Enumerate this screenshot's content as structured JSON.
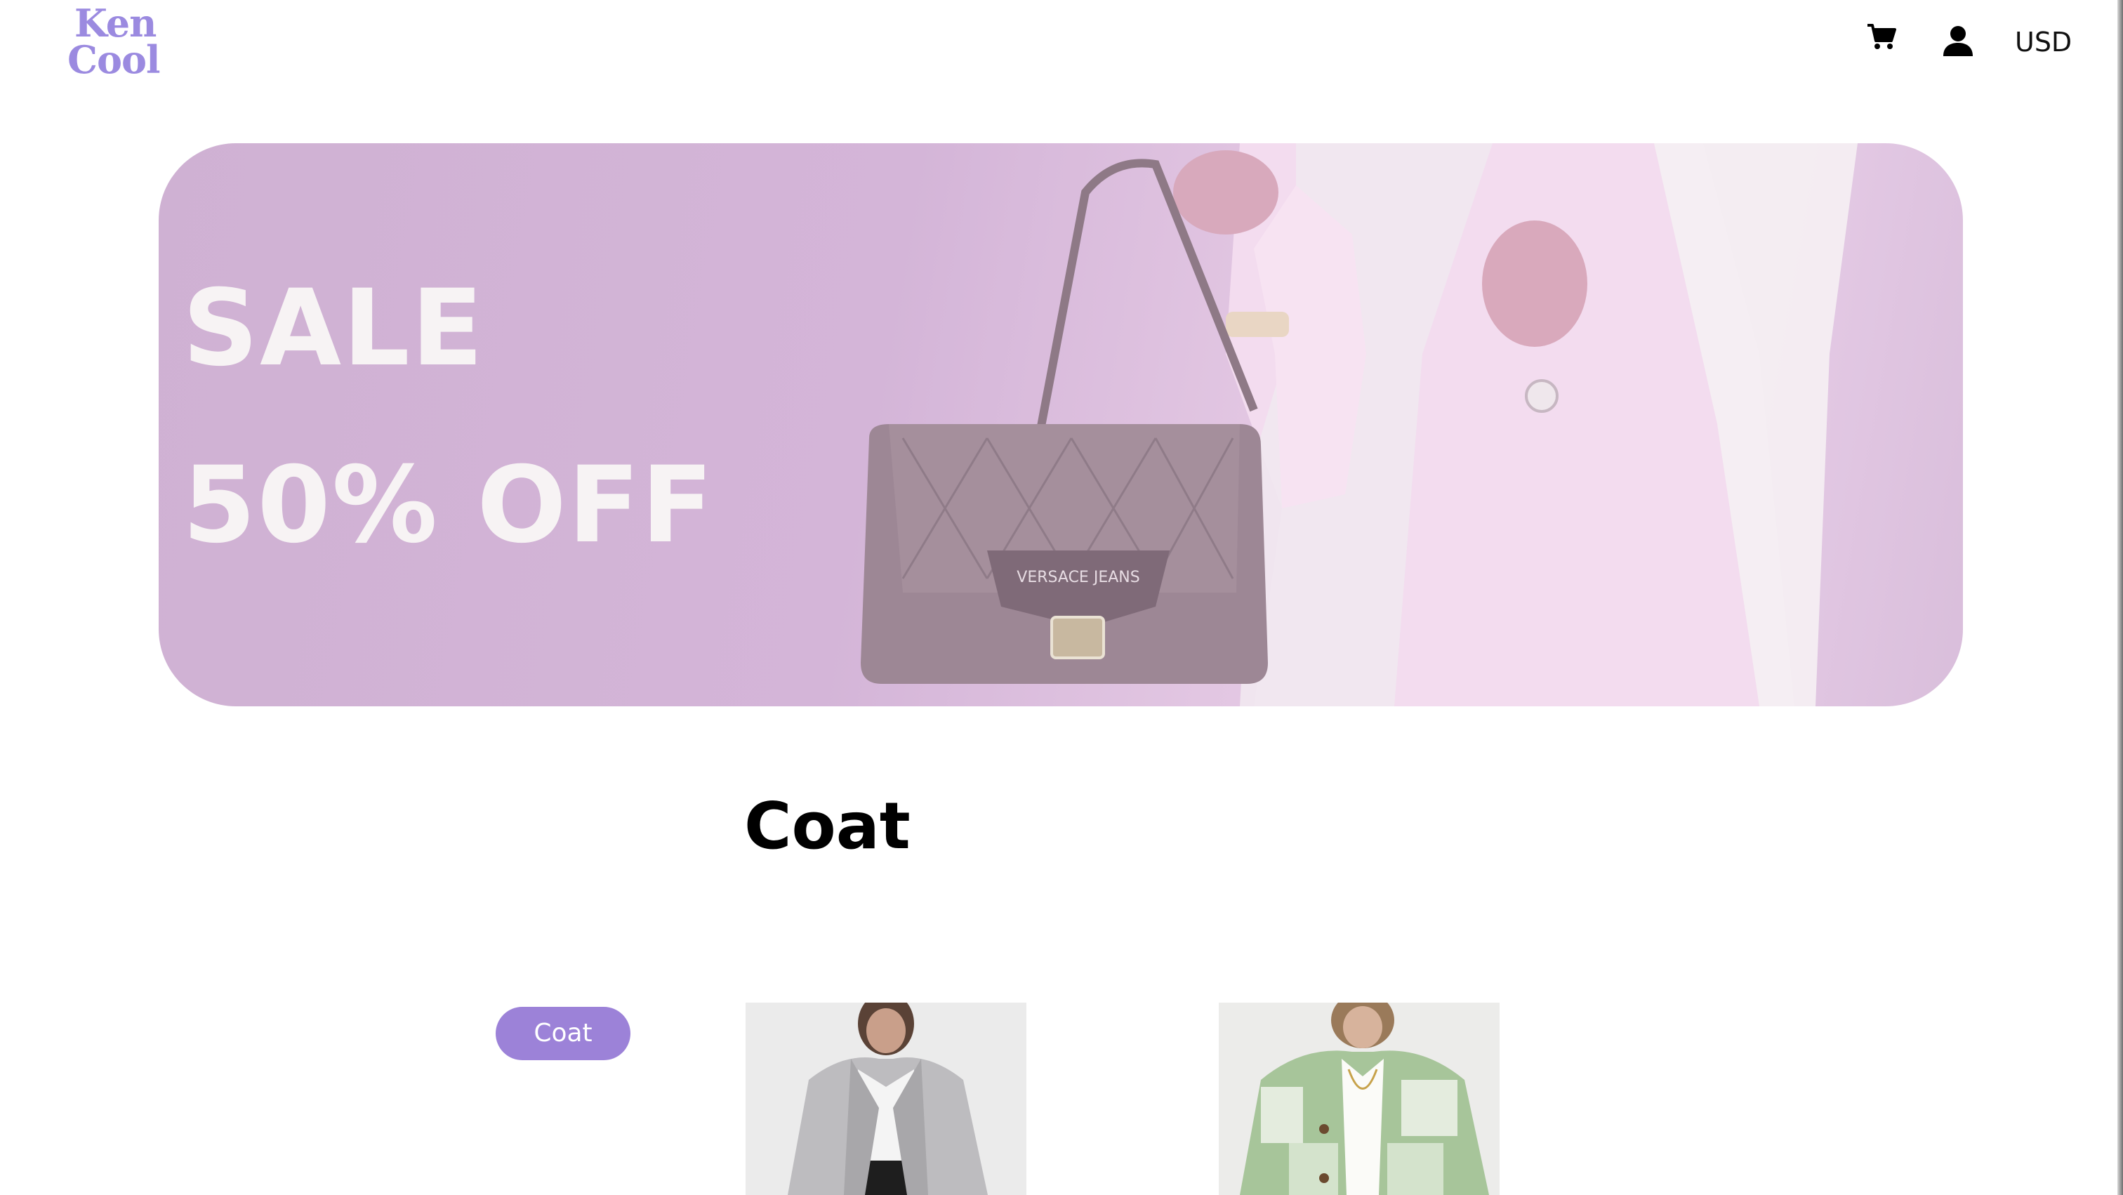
{
  "header": {
    "logo_line1": "Ken",
    "logo_line2": "Cool",
    "cart_icon": "cart-icon",
    "account_icon": "user-icon",
    "currency": "USD"
  },
  "hero": {
    "line1": "SALE",
    "line2": "50% OFF",
    "bag_logo": "VERSACE JEANS"
  },
  "section": {
    "title": "Coat"
  },
  "filters": {
    "active_category": "Coat"
  },
  "products": [
    {
      "image_desc": "grey fleece coat"
    },
    {
      "image_desc": "green and white plaid fleece jacket"
    }
  ],
  "colors": {
    "brand": "#9b8ae0",
    "pill": "#9c82d8",
    "hero_tint": "#d4b5d8"
  }
}
